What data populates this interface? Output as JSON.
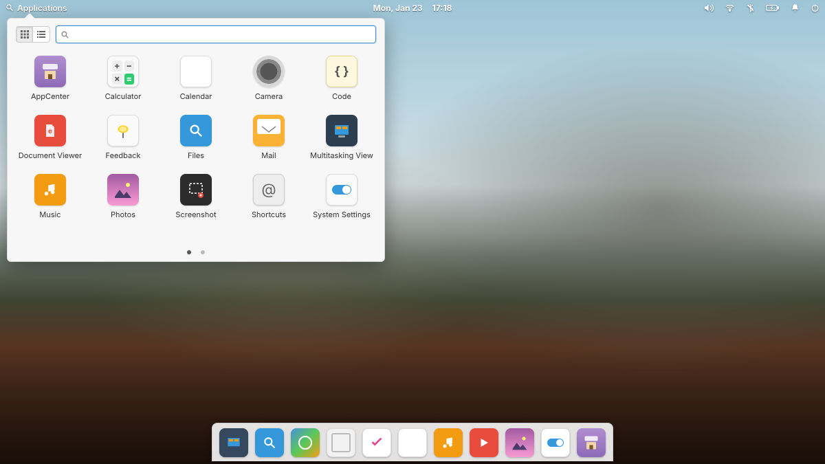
{
  "panel": {
    "applications": "Applications",
    "date": "Mon, Jan 23",
    "time": "17:18"
  },
  "launcher": {
    "search_placeholder": "",
    "apps": [
      {
        "label": "AppCenter"
      },
      {
        "label": "Calculator"
      },
      {
        "label": "Calendar"
      },
      {
        "label": "Camera"
      },
      {
        "label": "Code"
      },
      {
        "label": "Document Viewer"
      },
      {
        "label": "Feedback"
      },
      {
        "label": "Files"
      },
      {
        "label": "Mail"
      },
      {
        "label": "Multitasking View"
      },
      {
        "label": "Music"
      },
      {
        "label": "Photos"
      },
      {
        "label": "Screenshot"
      },
      {
        "label": "Shortcuts"
      },
      {
        "label": "System Settings"
      }
    ],
    "pages": 2,
    "current_page": 1
  },
  "dock": {
    "items": [
      {
        "name": "multitasking"
      },
      {
        "name": "files"
      },
      {
        "name": "web"
      },
      {
        "name": "mail"
      },
      {
        "name": "tasks"
      },
      {
        "name": "calendar"
      },
      {
        "name": "music"
      },
      {
        "name": "videos"
      },
      {
        "name": "photos"
      },
      {
        "name": "settings"
      },
      {
        "name": "appcenter"
      }
    ]
  }
}
